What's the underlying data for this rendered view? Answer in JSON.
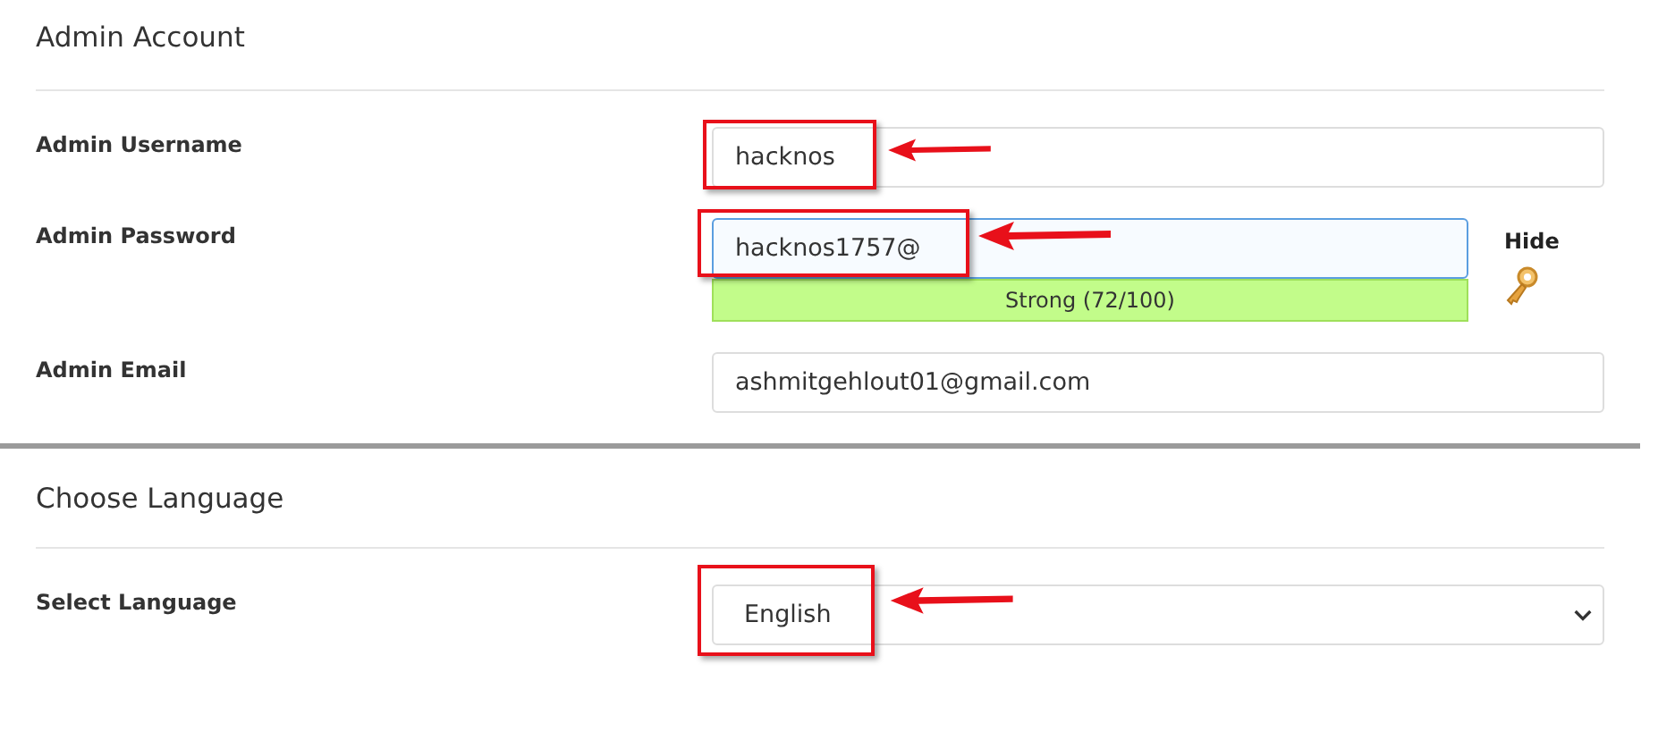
{
  "sections": [
    {
      "title": "Admin Account",
      "fields": [
        {
          "kind": "text",
          "label": "Admin Username",
          "value": "hacknos",
          "focused": false,
          "annotated": true
        },
        {
          "kind": "password",
          "label": "Admin Password",
          "value": "hacknos1757@",
          "focused": true,
          "annotated": true,
          "strength": "Strong (72/100)",
          "toggle": "Hide"
        },
        {
          "kind": "text",
          "label": "Admin Email",
          "value": "ashmitgehlout01@gmail.com",
          "focused": false,
          "annotated": false
        }
      ]
    },
    {
      "title": "Choose Language",
      "fields": [
        {
          "kind": "select",
          "label": "Select Language",
          "value": "English",
          "focused": false,
          "annotated": true
        }
      ]
    }
  ]
}
